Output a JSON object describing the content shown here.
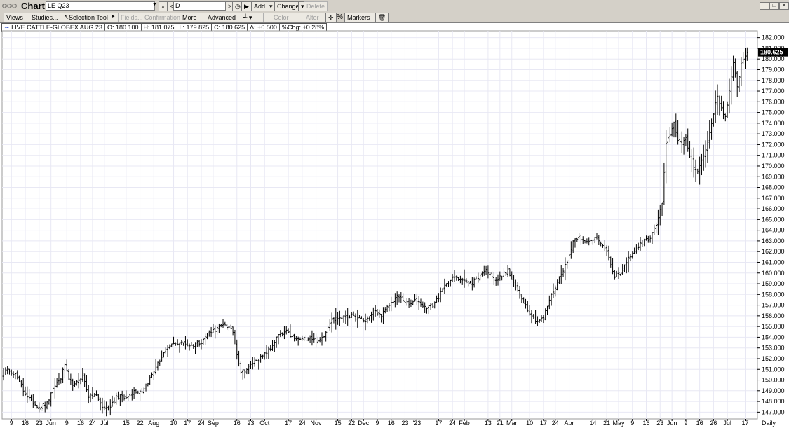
{
  "window": {
    "title": "Chart",
    "symbol_field": "LE Q23",
    "interval_field": "D",
    "add_label": "Add",
    "change_label": "Change",
    "delete_label": "Delete",
    "controls": [
      "_",
      "□",
      "×"
    ]
  },
  "toolbar": {
    "views": "Views",
    "studies": "Studies...",
    "selection_tool": "Selection Tool",
    "fields": "Fields...",
    "confirmation": "Confirmation",
    "more": "More",
    "advanced": "Advanced",
    "color": "Color",
    "alter": "Alter",
    "percent": "%",
    "markers": "Markers"
  },
  "info": {
    "name": "LIVE CATTLE-GLOBEX AUG 23",
    "open": "O: 180.100",
    "high": "H: 181.075",
    "low": "L: 179.825",
    "close": "C: 180.625",
    "change": "Δ: +0.500",
    "pct_change": "%Chg: +0.28%"
  },
  "last_price_label": "180.625",
  "period_label": "Daily",
  "colors": {
    "bars": "#000000",
    "grid": "#e8e8f4",
    "chrome": "#d4d0c8",
    "last_price_box": "#000000"
  },
  "chart_data": {
    "type": "ohlc",
    "ylim": [
      146.5,
      182.5
    ],
    "y_ticks": [
      "147.000",
      "148.000",
      "149.000",
      "150.000",
      "151.000",
      "152.000",
      "153.000",
      "154.000",
      "155.000",
      "156.000",
      "157.000",
      "158.000",
      "159.000",
      "160.000",
      "161.000",
      "162.000",
      "163.000",
      "164.000",
      "165.000",
      "166.000",
      "167.000",
      "168.000",
      "169.000",
      "170.000",
      "171.000",
      "172.000",
      "173.000",
      "174.000",
      "175.000",
      "176.000",
      "177.000",
      "178.000",
      "179.000",
      "180.000",
      "181.000",
      "182.000"
    ],
    "x_labels": [
      "9",
      "16",
      "23",
      "Jun",
      "9",
      "16",
      "24",
      "Jul",
      "15",
      "22",
      "Aug",
      "10",
      "17",
      "24",
      "Sep",
      "16",
      "23",
      "Oct",
      "17",
      "24",
      "Nov",
      "15",
      "22",
      "Dec",
      "9",
      "16",
      "23",
      "'23",
      "17",
      "24",
      "Feb",
      "13",
      "21",
      "Mar",
      "10",
      "17",
      "24",
      "Apr",
      "14",
      "21",
      "May",
      "9",
      "16",
      "23",
      "Jun",
      "9",
      "16",
      "26",
      "Jul",
      "17"
    ],
    "x_label_bars": [
      4,
      11,
      18,
      24,
      32,
      39,
      45,
      51,
      62,
      69,
      76,
      86,
      93,
      100,
      106,
      118,
      125,
      132,
      144,
      151,
      158,
      169,
      176,
      182,
      189,
      196,
      203,
      209,
      220,
      227,
      233,
      245,
      251,
      257,
      266,
      273,
      279,
      286,
      298,
      305,
      311,
      318,
      325,
      332,
      338,
      345,
      352,
      359,
      366,
      375
    ],
    "close_anchors": [
      [
        0,
        150.8
      ],
      [
        3,
        151.0
      ],
      [
        6,
        150.5
      ],
      [
        10,
        149.0
      ],
      [
        14,
        148.0
      ],
      [
        18,
        147.5
      ],
      [
        22,
        147.8
      ],
      [
        26,
        149.5
      ],
      [
        29,
        150.2
      ],
      [
        31,
        151.5
      ],
      [
        33,
        150.0
      ],
      [
        36,
        149.5
      ],
      [
        40,
        150.5
      ],
      [
        43,
        148.5
      ],
      [
        47,
        148.5
      ],
      [
        50,
        147.5
      ],
      [
        53,
        147.3
      ],
      [
        57,
        148.5
      ],
      [
        62,
        148.3
      ],
      [
        66,
        149.0
      ],
      [
        70,
        149.0
      ],
      [
        73,
        149.8
      ],
      [
        77,
        151.2
      ],
      [
        81,
        152.5
      ],
      [
        85,
        153.3
      ],
      [
        90,
        153.5
      ],
      [
        95,
        153.2
      ],
      [
        100,
        153.6
      ],
      [
        104,
        154.5
      ],
      [
        108,
        154.8
      ],
      [
        112,
        155.2
      ],
      [
        116,
        154.5
      ],
      [
        118,
        152.5
      ],
      [
        120,
        150.8
      ],
      [
        123,
        151.0
      ],
      [
        127,
        151.8
      ],
      [
        131,
        152.2
      ],
      [
        135,
        153.0
      ],
      [
        139,
        154.2
      ],
      [
        143,
        154.5
      ],
      [
        147,
        153.8
      ],
      [
        151,
        153.8
      ],
      [
        155,
        154.0
      ],
      [
        159,
        153.5
      ],
      [
        162,
        154.2
      ],
      [
        166,
        155.8
      ],
      [
        170,
        155.8
      ],
      [
        175,
        156.0
      ],
      [
        179,
        155.8
      ],
      [
        183,
        155.5
      ],
      [
        187,
        156.5
      ],
      [
        191,
        156.0
      ],
      [
        195,
        157.0
      ],
      [
        199,
        157.8
      ],
      [
        202,
        157.5
      ],
      [
        205,
        157.0
      ],
      [
        209,
        157.5
      ],
      [
        213,
        156.8
      ],
      [
        217,
        157.0
      ],
      [
        220,
        157.8
      ],
      [
        224,
        159.0
      ],
      [
        228,
        159.6
      ],
      [
        232,
        159.5
      ],
      [
        236,
        159.0
      ],
      [
        240,
        159.6
      ],
      [
        243,
        160.3
      ],
      [
        246,
        160.0
      ],
      [
        249,
        159.2
      ],
      [
        252,
        159.8
      ],
      [
        255,
        160.2
      ],
      [
        258,
        159.0
      ],
      [
        261,
        158.0
      ],
      [
        264,
        157.0
      ],
      [
        267,
        156.0
      ],
      [
        270,
        155.5
      ],
      [
        273,
        155.8
      ],
      [
        276,
        157.5
      ],
      [
        279,
        158.7
      ],
      [
        282,
        160.0
      ],
      [
        285,
        161.0
      ],
      [
        288,
        163.0
      ],
      [
        291,
        163.5
      ],
      [
        294,
        162.8
      ],
      [
        297,
        163.0
      ],
      [
        300,
        163.5
      ],
      [
        303,
        162.5
      ],
      [
        306,
        161.5
      ],
      [
        309,
        159.5
      ],
      [
        312,
        160.0
      ],
      [
        315,
        161.0
      ],
      [
        318,
        162.0
      ],
      [
        321,
        162.5
      ],
      [
        324,
        163.0
      ],
      [
        327,
        163.3
      ],
      [
        330,
        164.5
      ],
      [
        333,
        166.5
      ],
      [
        335,
        172.0
      ],
      [
        337,
        173.0
      ],
      [
        339,
        174.0
      ],
      [
        341,
        172.5
      ],
      [
        343,
        172.0
      ],
      [
        345,
        172.5
      ],
      [
        347,
        171.0
      ],
      [
        349,
        170.0
      ],
      [
        351,
        169.5
      ],
      [
        353,
        170.5
      ],
      [
        355,
        171.5
      ],
      [
        357,
        173.0
      ],
      [
        359,
        175.0
      ],
      [
        361,
        176.5
      ],
      [
        363,
        175.5
      ],
      [
        365,
        174.5
      ],
      [
        367,
        177.0
      ],
      [
        369,
        179.5
      ],
      [
        371,
        177.5
      ],
      [
        373,
        179.5
      ],
      [
        375,
        180.4
      ],
      [
        376,
        180.625
      ]
    ]
  }
}
